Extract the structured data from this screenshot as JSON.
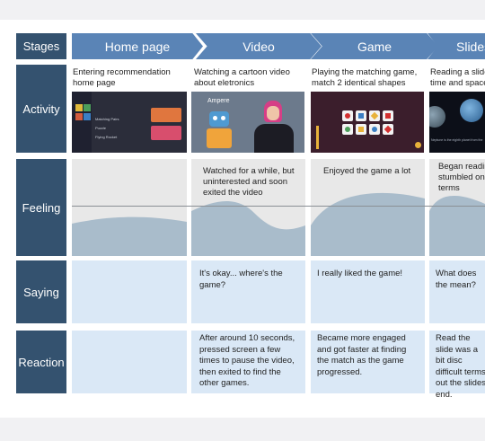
{
  "rows": {
    "stages": "Stages",
    "activity": "Activity",
    "feeling": "Feeling",
    "saying": "Saying",
    "reaction": "Reaction"
  },
  "columns": [
    {
      "stage": "Home page",
      "activity": "Entering recommendation home page",
      "feeling": "",
      "saying": "",
      "reaction": ""
    },
    {
      "stage": "Video",
      "activity": "Watching a cartoon video about eletronics",
      "feeling": "Watched for a while, but uninterested and soon exited the video",
      "saying": "It's okay... where's the game?",
      "reaction": "After around 10 seconds, pressed screen a few times to pause the video, then exited to find the other games."
    },
    {
      "stage": "Game",
      "activity": "Playing the matching game, match 2 identical shapes",
      "feeling": "Enjoyed the game a lot",
      "saying": "I really liked the game!",
      "reaction": "Became more engaged and got faster at finding the match as the game progressed."
    },
    {
      "stage": "Slides",
      "activity": "Reading a slide time and space",
      "feeling": "Began reading stumbled on terms",
      "saying": "What does the mean?",
      "reaction": "Read the slide was a bit disc difficult terms out the slides end."
    }
  ],
  "thumbs": {
    "home": {
      "items": [
        "Matching Pairs",
        "Puzzle",
        "Flying Rocket"
      ]
    },
    "video": {
      "label": "Ampere"
    },
    "slides": {
      "caption": "Neptune is the eighth planet from the sun."
    }
  },
  "colors": {
    "header": "#34526f",
    "stage": "#5a84b6",
    "cell": "#dae8f6",
    "curve": "#a9bccb"
  }
}
